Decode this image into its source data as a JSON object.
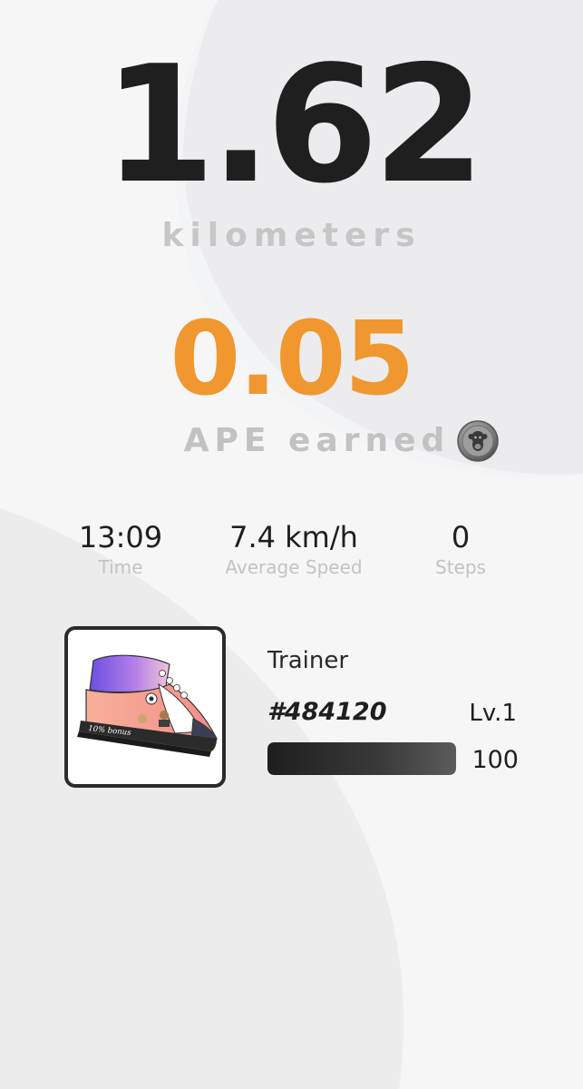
{
  "run": {
    "distance": "1.62",
    "distance_unit": "kilometers",
    "earned": "0.05",
    "earned_label": "APE earned",
    "coin_icon": "ape-coin-icon"
  },
  "stats": [
    {
      "value": "13:09",
      "label": "Time"
    },
    {
      "value": "7.4 km/h",
      "label": "Average Speed"
    },
    {
      "value": "0",
      "label": "Steps"
    }
  ],
  "trainer": {
    "label": "Trainer",
    "id": "#484120",
    "level": "Lv.1",
    "shoe_text": "10% bonus",
    "progress_value": "100",
    "progress_fraction": 1.0
  },
  "colors": {
    "accent": "#f0972f",
    "text_dark": "#1f1f1f",
    "text_muted": "#c3c3c3",
    "background": "#f2f3f5"
  }
}
